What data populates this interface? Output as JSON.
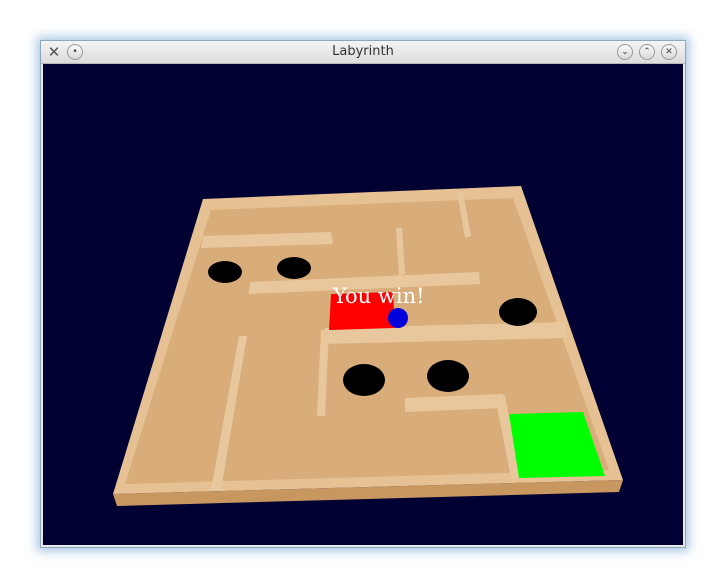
{
  "window": {
    "title": "Labyrinth",
    "controls": [
      "minimize",
      "maximize",
      "close"
    ]
  },
  "game": {
    "status_message": "You win!",
    "colors": {
      "background": "#000033",
      "board": "#d8ad7a",
      "wall_top": "#e9c79c",
      "frame_side": "#c8965f",
      "hole": "#000000",
      "start_pad": "#ff0000",
      "goal_pad": "#00ff00",
      "ball": "#0000dd",
      "text": "#ffffff"
    },
    "holes": 5
  }
}
